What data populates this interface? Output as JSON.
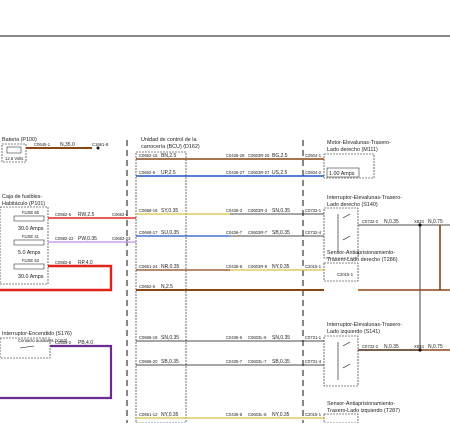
{
  "components": {
    "bateria": {
      "label": "Bateria (P100)",
      "sub": "12.6 Volts"
    },
    "caja_fusibles": {
      "label1": "Caja de fusibles-",
      "label2": "Habitáculo (P101)"
    },
    "fuse65": {
      "label": "FUSE 65",
      "rating": "30.0 Amps"
    },
    "fuse41": {
      "label": "FUSE 41",
      "rating": "5.0 Amps"
    },
    "fuse53": {
      "label": "FUSE 53",
      "rating": "30.0 Amps"
    },
    "interruptor_encendido": {
      "label": "Interruptor-Encendido (S176)",
      "sub": "Contacto auxiliares (Y163)"
    },
    "bcu": {
      "label1": "Unidad de control de la",
      "label2": "carrocería (BCU) (D162)"
    },
    "motor": {
      "label1": "Motor-Elevalunas-Trasero-",
      "label2": "Lado derecho (M111)",
      "rating": "1.00 Amps"
    },
    "interruptor_td": {
      "label1": "Interruptor-Elevalunas-Trasero-",
      "label2": "Lado derecho (S140)"
    },
    "sensor_td": {
      "label1": "Sensor-Antiaprisionamiento-",
      "label2": "Trasero-Lado derecho (T286)"
    },
    "interruptor_ti": {
      "label1": "Interruptor-Elevalunas-Trasero-",
      "label2": "Lado izquierdo (S141)"
    },
    "sensor_ti": {
      "label1": "Sensor-Antiaprisionamiento-",
      "label2": "Trasero-Lado izquierdo (T287)"
    }
  },
  "connectors": {
    "bat_c1": "C0645-1",
    "bat_c2": "C1661-8",
    "fuse65_c1": "C0582-5",
    "fuse65_c2": "C0662-4",
    "fuse41_c1": "C0582-22",
    "fuse41_c2": "C0662-23",
    "fuse53_c1": "C0582-8",
    "ign_c1": "C0559-2",
    "r1_c1": "C0662-15",
    "r1_c2": "C0436-26",
    "r1_c3": "C0603R-26",
    "r1_c4": "C0504-1",
    "r2_c1": "C0662-5",
    "r2_c2": "C0436-27",
    "r2_c3": "C0603R-27",
    "r2_c4": "C0504-2",
    "r3_c1": "C0668-18",
    "r3_c2": "C0436-3",
    "r3_c3": "C0603R-3",
    "r3_c4": "C0732-1",
    "r3_c5": "C0732-2",
    "r3_c6": "X834",
    "r4_c1": "C0668-17",
    "r4_c2": "C0436-7",
    "r4_c3": "C0603R-7",
    "r4_c4": "C0732-4",
    "r5_c1": "C0661-24",
    "r5_c2": "C0436-8",
    "r5_c3": "C0603R-8",
    "r5_c4": "C2015-1",
    "r5_c5": "C2015-1",
    "r6_c1": "C0662-6",
    "r7_c1": "C0668-18",
    "r7_c2": "C0436-6",
    "r7_c3": "C0603L-6",
    "r7_c4": "C0731-1",
    "r7_c5": "C0732-2",
    "r7_c6": "X834",
    "r8_c1": "C0668-20",
    "r8_c2": "C0435-7",
    "r8_c3": "C0603L-7",
    "r8_c4": "C0731-4",
    "r9_c1": "C0661-12",
    "r9_c2": "C0436-8",
    "r9_c3": "C0603L-8",
    "r9_c4": "C2015-1"
  },
  "wires": {
    "bat": "N,35.0",
    "fuse65": "RW,2.5",
    "fuse41": "PW,0.35",
    "fuse53": "RP,4.0",
    "ign": "PB,4.0",
    "r1a": "BN,2.5",
    "r1b": "BG,2.5",
    "r2a": "UP,2.5",
    "r2b": "US,2.5",
    "r3a": "SY,0.35",
    "r3b": "SN,0.35",
    "r3c": "N,0.35",
    "r3d": "N,0.75",
    "r4a": "SU,0.35",
    "r4b": "SB,0.35",
    "r5a": "NR,0.35",
    "r5b": "NY,0.35",
    "r6a": "N,2.5",
    "r7a": "SN,0.35",
    "r7b": "SN,0.35",
    "r7c": "N,0.35",
    "r7d": "N,0.75",
    "r8a": "SB,0.35",
    "r8b": "SB,0.35",
    "r9a": "NY,0.35",
    "r9b": "NY,0.35"
  },
  "colors": {
    "brown": "#8b4513",
    "red": "#e0241b",
    "purple": "#6a2c91",
    "blue": "#1f57c5",
    "yellow": "#d9c23a",
    "lilac": "#c7a0e8",
    "black": "#111111"
  }
}
